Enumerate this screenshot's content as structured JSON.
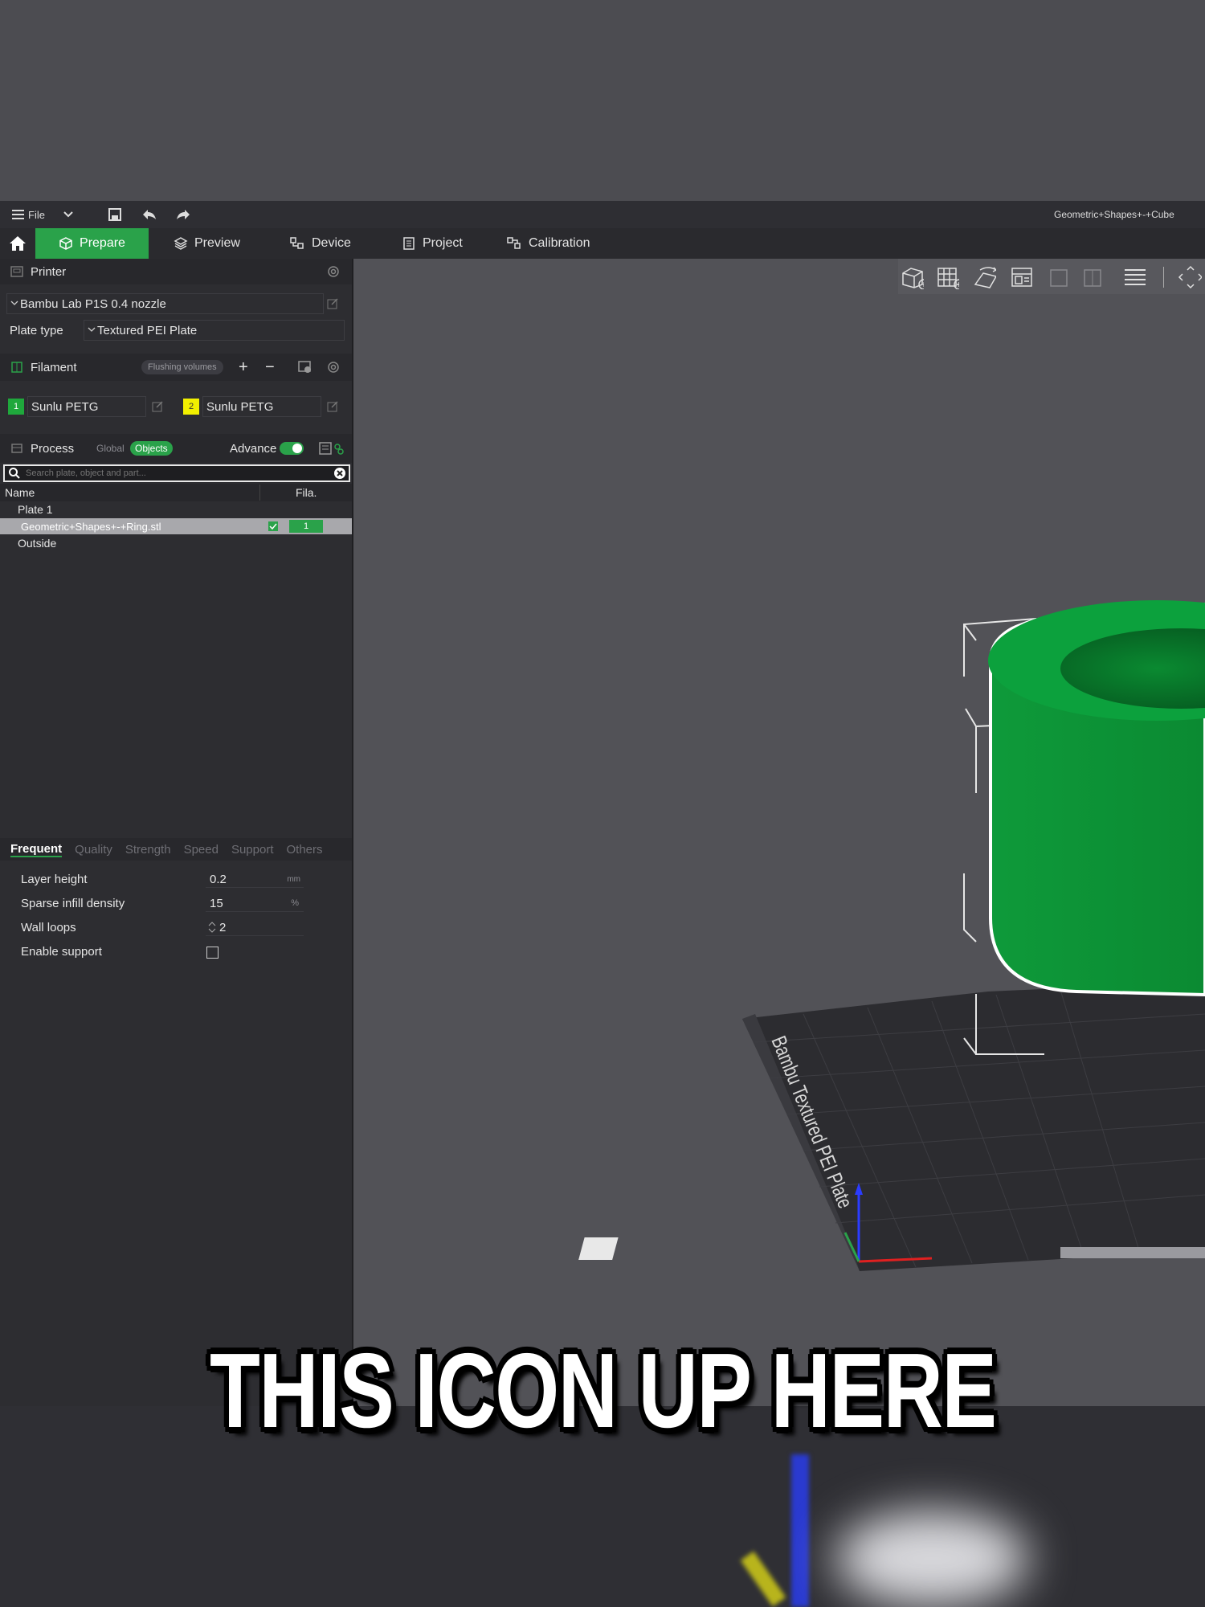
{
  "menubar": {
    "file_label": "File",
    "window_title": "Geometric+Shapes+-+Cube"
  },
  "tabs": {
    "prepare": "Prepare",
    "preview": "Preview",
    "device": "Device",
    "project": "Project",
    "calibration": "Calibration"
  },
  "printer": {
    "section_label": "Printer",
    "preset": "Bambu Lab P1S 0.4 nozzle",
    "plate_type_label": "Plate type",
    "plate_type_value": "Textured PEI Plate"
  },
  "filament": {
    "section_label": "Filament",
    "flushing_label": "Flushing volumes",
    "items": [
      {
        "index": "1",
        "name": "Sunlu PETG",
        "color": "#1fa83c"
      },
      {
        "index": "2",
        "name": "Sunlu PETG",
        "color": "#f2f000"
      }
    ]
  },
  "process": {
    "section_label": "Process",
    "global_label": "Global",
    "objects_label": "Objects",
    "advance_label": "Advance",
    "search_placeholder": "Search plate, object and part..."
  },
  "object_list": {
    "col_name": "Name",
    "col_fila": "Fila.",
    "plate_label": "Plate 1",
    "object_name": "Geometric+Shapes+-+Ring.stl",
    "object_fila": "1",
    "outside_label": "Outside"
  },
  "settings_tabs": [
    "Frequent",
    "Quality",
    "Strength",
    "Speed",
    "Support",
    "Others"
  ],
  "settings": {
    "layer_height_label": "Layer height",
    "layer_height_value": "0.2",
    "layer_height_unit": "mm",
    "infill_label": "Sparse infill density",
    "infill_value": "15",
    "infill_unit": "%",
    "wall_loops_label": "Wall loops",
    "wall_loops_value": "2",
    "support_label": "Enable support"
  },
  "plate_text": "Bambu Textured PEI Plate",
  "caption": "THIS ICON UP HERE",
  "colors": {
    "accent": "#2aa24a",
    "model": "#0e9a3a"
  }
}
